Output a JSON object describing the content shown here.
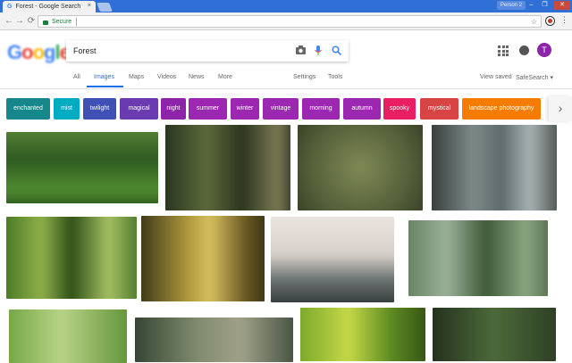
{
  "browser": {
    "tab_title": "Forest - Google Search",
    "tab_icon": "G",
    "tab_close": "×",
    "profile_label": "Person 2",
    "window_controls": [
      "–",
      "❐",
      "✕"
    ],
    "nav": {
      "back": "←",
      "forward": "→",
      "reload": "⟳"
    },
    "omnibox_secure": "Secure",
    "star": "☆",
    "menu": "⋮"
  },
  "google": {
    "logo": [
      "G",
      "o",
      "o",
      "g",
      "l",
      "e"
    ],
    "query": "Forest",
    "camera_icon": "📷",
    "mic_icon": "🎤",
    "search_icon": "🔍",
    "avatar_initial": "T"
  },
  "tabs": [
    "All",
    "Images",
    "Maps",
    "Videos",
    "News",
    "More",
    "Settings",
    "Tools"
  ],
  "right_links": {
    "view_saved": "View saved",
    "safesearch": "SafeSearch ▾"
  },
  "chips": [
    {
      "label": "enchanted",
      "color": "#16878a"
    },
    {
      "label": "mist",
      "color": "#00acc1"
    },
    {
      "label": "twilight",
      "color": "#3f51b5"
    },
    {
      "label": "magical",
      "color": "#6a3ab0"
    },
    {
      "label": "night",
      "color": "#8e24aa"
    },
    {
      "label": "summer",
      "color": "#9c27b0"
    },
    {
      "label": "winter",
      "color": "#9c27b0"
    },
    {
      "label": "vintage",
      "color": "#9c27b0"
    },
    {
      "label": "morning",
      "color": "#9c27b0"
    },
    {
      "label": "autumn",
      "color": "#9c27b0"
    },
    {
      "label": "spooky",
      "color": "#e91e63"
    },
    {
      "label": "mystical",
      "color": "#d84343"
    },
    {
      "label": "landscape photography",
      "color": "#f57c00"
    }
  ],
  "chip_arrow": "›"
}
